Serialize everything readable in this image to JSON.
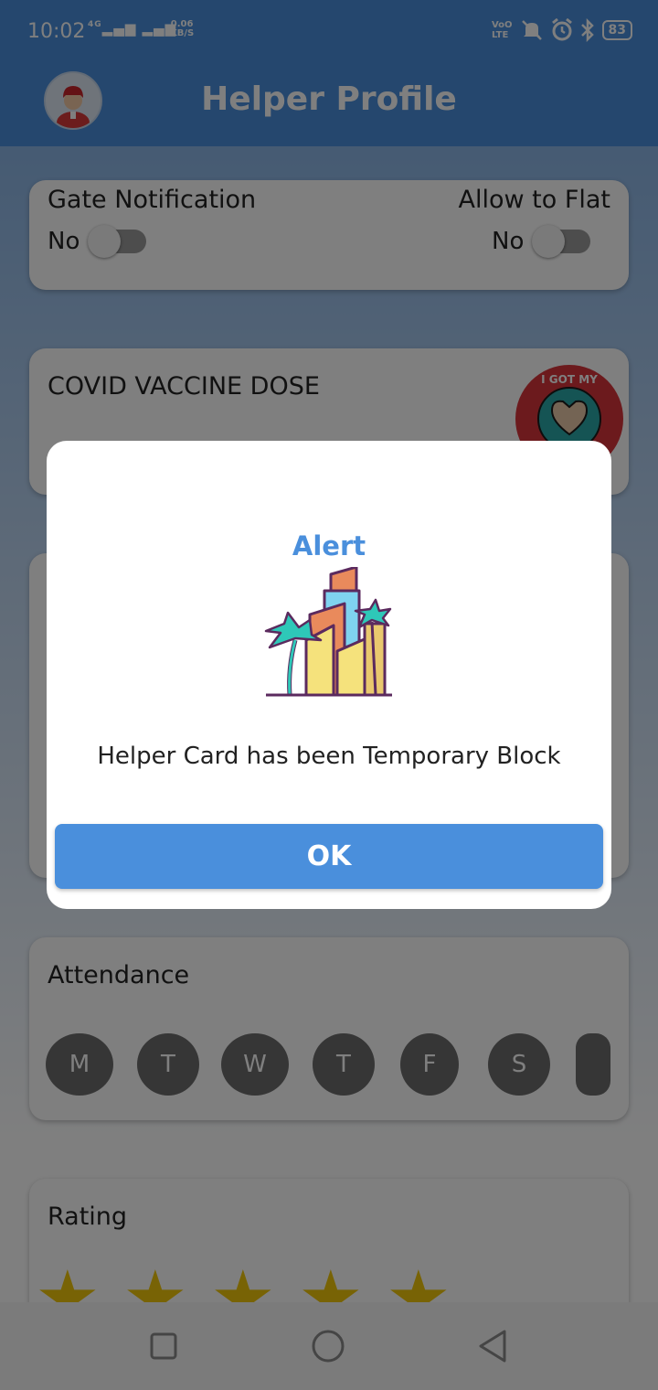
{
  "status_bar": {
    "time": "10:02",
    "network": "4G",
    "speed_value": "0.06",
    "speed_unit": "KB/S",
    "volte_line1": "VoO",
    "volte_line2": "LTE",
    "battery": "83"
  },
  "header": {
    "title": "Helper Profile"
  },
  "gate_card": {
    "gate_notification_label": "Gate Notification",
    "gate_notification_value": "No",
    "allow_to_flat_label": "Allow to Flat",
    "allow_to_flat_value": "No"
  },
  "vaccine_card": {
    "title": "COVID VACCINE DOSE",
    "badge_text": "I GOT MY COVID VACCINE"
  },
  "attendance": {
    "title": "Attendance",
    "days": [
      "M",
      "T",
      "W",
      "T",
      "F",
      "S"
    ]
  },
  "rating": {
    "title": "Rating",
    "stars_shown": 5
  },
  "dialog": {
    "title": "Alert",
    "message": "Helper Card has been Temporary Block",
    "ok_label": "OK"
  },
  "colors": {
    "primary": "#4a8fdc",
    "toggle_off": "#9a9a9a",
    "day_circle": "#6c6c6c",
    "star": "#f1c70a"
  }
}
